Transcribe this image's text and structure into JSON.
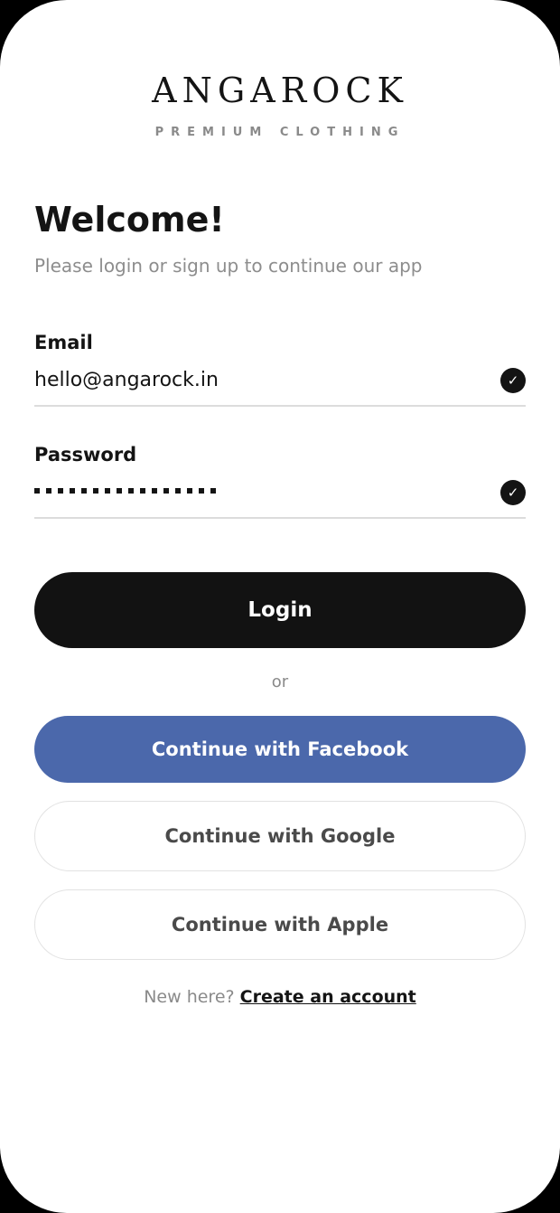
{
  "brand": {
    "name": "ANGAROCK",
    "tagline": "PREMIUM CLOTHING"
  },
  "welcome": {
    "title": "Welcome!",
    "subtitle": "Please login or sign up to continue our app"
  },
  "form": {
    "email": {
      "label": "Email",
      "value": "hello@angarock.in",
      "valid_icon": "check-circle-icon"
    },
    "password": {
      "label": "Password",
      "masked_length": 16,
      "valid_icon": "check-circle-icon"
    }
  },
  "actions": {
    "login_label": "Login",
    "divider_text": "or",
    "facebook_label": "Continue with Facebook",
    "google_label": "Continue with Google",
    "apple_label": "Continue with Apple"
  },
  "footer": {
    "prompt": "New here?",
    "link_label": "Create an account"
  },
  "colors": {
    "primary": "#121212",
    "facebook": "#4b68ab",
    "muted_text": "#8a8a8a",
    "divider": "#dcdcdc"
  }
}
